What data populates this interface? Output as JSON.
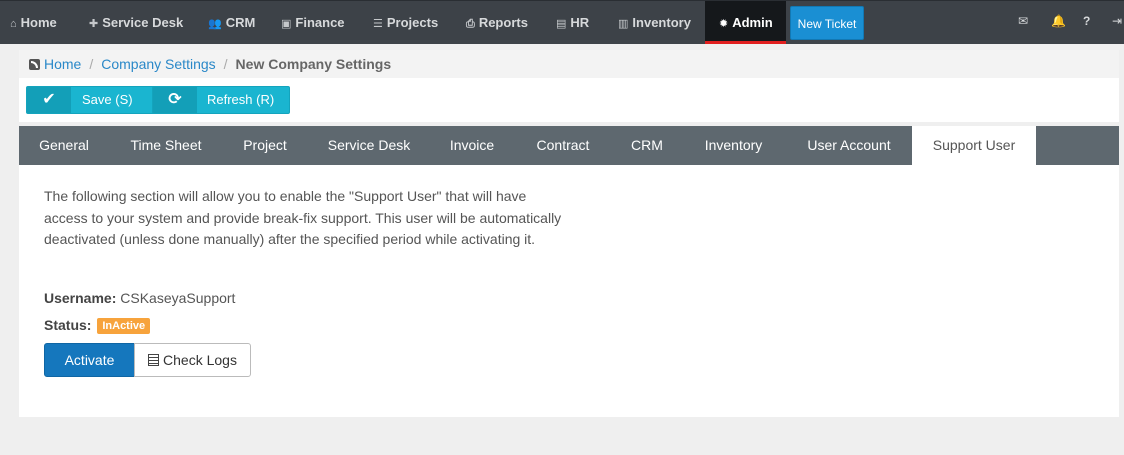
{
  "nav": {
    "items": [
      {
        "icon": "home-icon",
        "glyph": "⌂",
        "label": "Home"
      },
      {
        "icon": "puzzle-icon",
        "glyph": "✚",
        "label": "Service Desk"
      },
      {
        "icon": "users-icon",
        "glyph": "👥",
        "label": "CRM"
      },
      {
        "icon": "money-icon",
        "glyph": "▣",
        "label": "Finance"
      },
      {
        "icon": "list-icon",
        "glyph": "☰",
        "label": "Projects"
      },
      {
        "icon": "print-icon",
        "glyph": "⎙",
        "label": "Reports"
      },
      {
        "icon": "briefcase-icon",
        "glyph": "▤",
        "label": "HR"
      },
      {
        "icon": "building-icon",
        "glyph": "▥",
        "label": "Inventory"
      },
      {
        "icon": "gear-icon",
        "glyph": "✹",
        "label": "Admin"
      }
    ],
    "new_ticket": "New Ticket",
    "right_icons": [
      {
        "icon": "envelope-icon",
        "glyph": "✉"
      },
      {
        "icon": "bell-icon",
        "glyph": "🔔"
      },
      {
        "icon": "help-icon",
        "glyph": "?"
      },
      {
        "icon": "signout-icon",
        "glyph": "⇥"
      }
    ]
  },
  "breadcrumb": {
    "home": "Home",
    "company_settings": "Company Settings",
    "current": "New Company Settings",
    "separator": "/"
  },
  "toolbar": {
    "save_label": "Save (S)",
    "save_glyph": "✔",
    "refresh_label": "Refresh (R)",
    "refresh_glyph": "⟳"
  },
  "tabs": [
    {
      "label": "General"
    },
    {
      "label": "Time Sheet"
    },
    {
      "label": "Project"
    },
    {
      "label": "Service Desk"
    },
    {
      "label": "Invoice"
    },
    {
      "label": "Contract"
    },
    {
      "label": "CRM"
    },
    {
      "label": "Inventory"
    },
    {
      "label": "User Account"
    },
    {
      "label": "Support User",
      "active": true
    }
  ],
  "support": {
    "description": "The following section will allow you to enable the \"Support User\" that will have access to your system and provide break-fix support. This user will be automatically deactivated (unless done manually) after the specified period while activating it.",
    "username_label": "Username:",
    "username_value": "CSKaseyaSupport",
    "status_label": "Status:",
    "status_value": "InActive",
    "activate_label": "Activate",
    "check_logs_label": "Check Logs"
  },
  "colors": {
    "nav_bg": "#3d4248",
    "accent_blue": "#1a8fd3",
    "toolbar_cyan": "#1ab5d0",
    "tabs_bg": "#5e686f",
    "status_badge": "#f7a33c",
    "activate_btn": "#1577bd",
    "active_tab_underline": "#e01e1e"
  }
}
